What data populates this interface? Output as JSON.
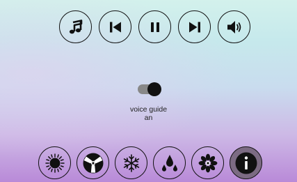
{
  "media_controls": [
    {
      "name": "music-note-icon",
      "action": "music"
    },
    {
      "name": "previous-track-icon",
      "action": "previous"
    },
    {
      "name": "pause-icon",
      "action": "pause"
    },
    {
      "name": "next-track-icon",
      "action": "next"
    },
    {
      "name": "volume-icon",
      "action": "volume"
    }
  ],
  "voice_guide": {
    "label": "voice guide",
    "state": "an",
    "enabled": true
  },
  "climate_controls": [
    {
      "name": "sun-icon",
      "action": "brightness"
    },
    {
      "name": "fan-icon",
      "action": "fan"
    },
    {
      "name": "snowflake-icon",
      "action": "cooling"
    },
    {
      "name": "water-drops-icon",
      "action": "humidity"
    },
    {
      "name": "flower-icon",
      "action": "fragrance"
    },
    {
      "name": "info-icon",
      "action": "info",
      "active": true
    }
  ],
  "colors": {
    "active_button": "#7c6b83",
    "toggle_knob": "#111111",
    "toggle_track": "#888888"
  }
}
